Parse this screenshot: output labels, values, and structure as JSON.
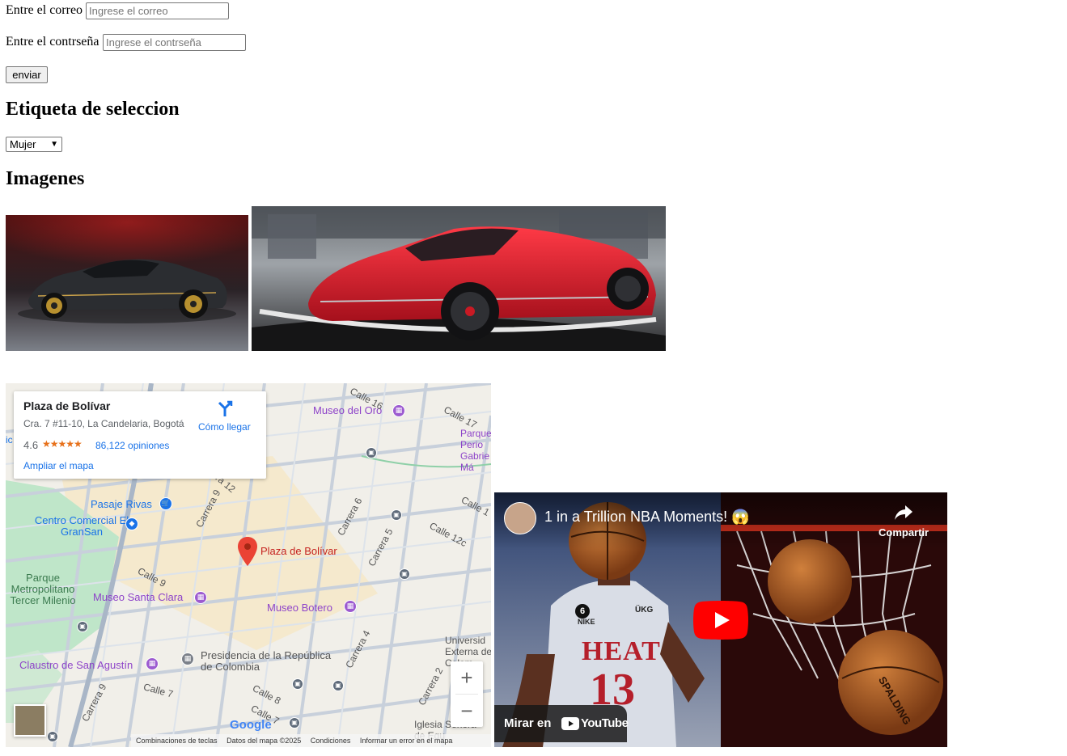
{
  "form": {
    "email_label": "Entre el correo",
    "email_placeholder": "Ingrese el correo",
    "password_label": "Entre el contrseña",
    "password_placeholder": "Ingrese el contrseña",
    "submit_label": "enviar"
  },
  "select_section": {
    "heading": "Etiqueta de seleccion",
    "selected": "Mujer"
  },
  "images_section": {
    "heading": "Imagenes"
  },
  "map": {
    "place_name": "Plaza de Bolívar",
    "address": "Cra. 7 #11-10, La Candelaria, Bogotá",
    "rating": "4.6",
    "stars": "★★★★★",
    "reviews": "86,122 opiniones",
    "directions": "Cómo llegar",
    "enlarge": "Ampliar el mapa",
    "pin_label": "Plaza de Bolívar",
    "pois": {
      "museo_oro": "Museo del Oro",
      "pasaje_rivas": "Pasaje Rivas",
      "centro_comercial": "Centro Comercial El GranSan",
      "parque_tercer": "Parque Metropolitano Tercer Milenio",
      "museo_santa_clara": "Museo Santa Clara",
      "museo_botero": "Museo Botero",
      "presidencia": "Presidencia de la República de Colombia",
      "claustro": "Claustro de San Agustín",
      "parque_periodistas": "Parque Perio Gabrie Má",
      "universidad": "Universid Externa de Colom",
      "iglesia": "Iglesia Señora de Equ"
    },
    "streets": {
      "calle16": "Calle 16",
      "calle17": "Calle 17",
      "calle12": "Calle 12",
      "calle12c": "Calle 12c",
      "calle9": "Calle 9",
      "calle8": "Calle 8",
      "calle7a": "Calle 7",
      "calle7b": "Calle 7",
      "calle1": "Calle 1",
      "carrera9a": "Carrera 9",
      "carrera9b": "Carrera 9",
      "carrera6": "Carrera 6",
      "carrera5": "Carrera 5",
      "carrera4": "Carrera 4",
      "carrera2": "Carrera 2",
      "carrera12": "ra 12",
      "edge_ic": "ic"
    },
    "zoom_in": "+",
    "zoom_out": "−",
    "google_logo": "Google",
    "footer": {
      "shortcuts": "Combinaciones de teclas",
      "data": "Datos del mapa ©2025",
      "terms": "Condiciones",
      "report": "Informar un error en el mapa"
    }
  },
  "video": {
    "title": "1 in a Trillion NBA Moments! 😱",
    "share": "Compartir",
    "watch_on": "Mirar en",
    "youtube": "YouTube",
    "jersey_text": "HEAT",
    "jersey_number": "13",
    "badge_6": "6",
    "brand_nike": "NIKE",
    "brand_ukg": "ÜKG",
    "ball_brand": "SPALDING"
  },
  "colors": {
    "link_blue": "#1a73e8",
    "poi_purple": "#8e44c9",
    "pin_red": "#ea4335",
    "youtube_red": "#ff0000",
    "park_green": "#b7e3c0",
    "map_bg": "#f2f0eb"
  }
}
